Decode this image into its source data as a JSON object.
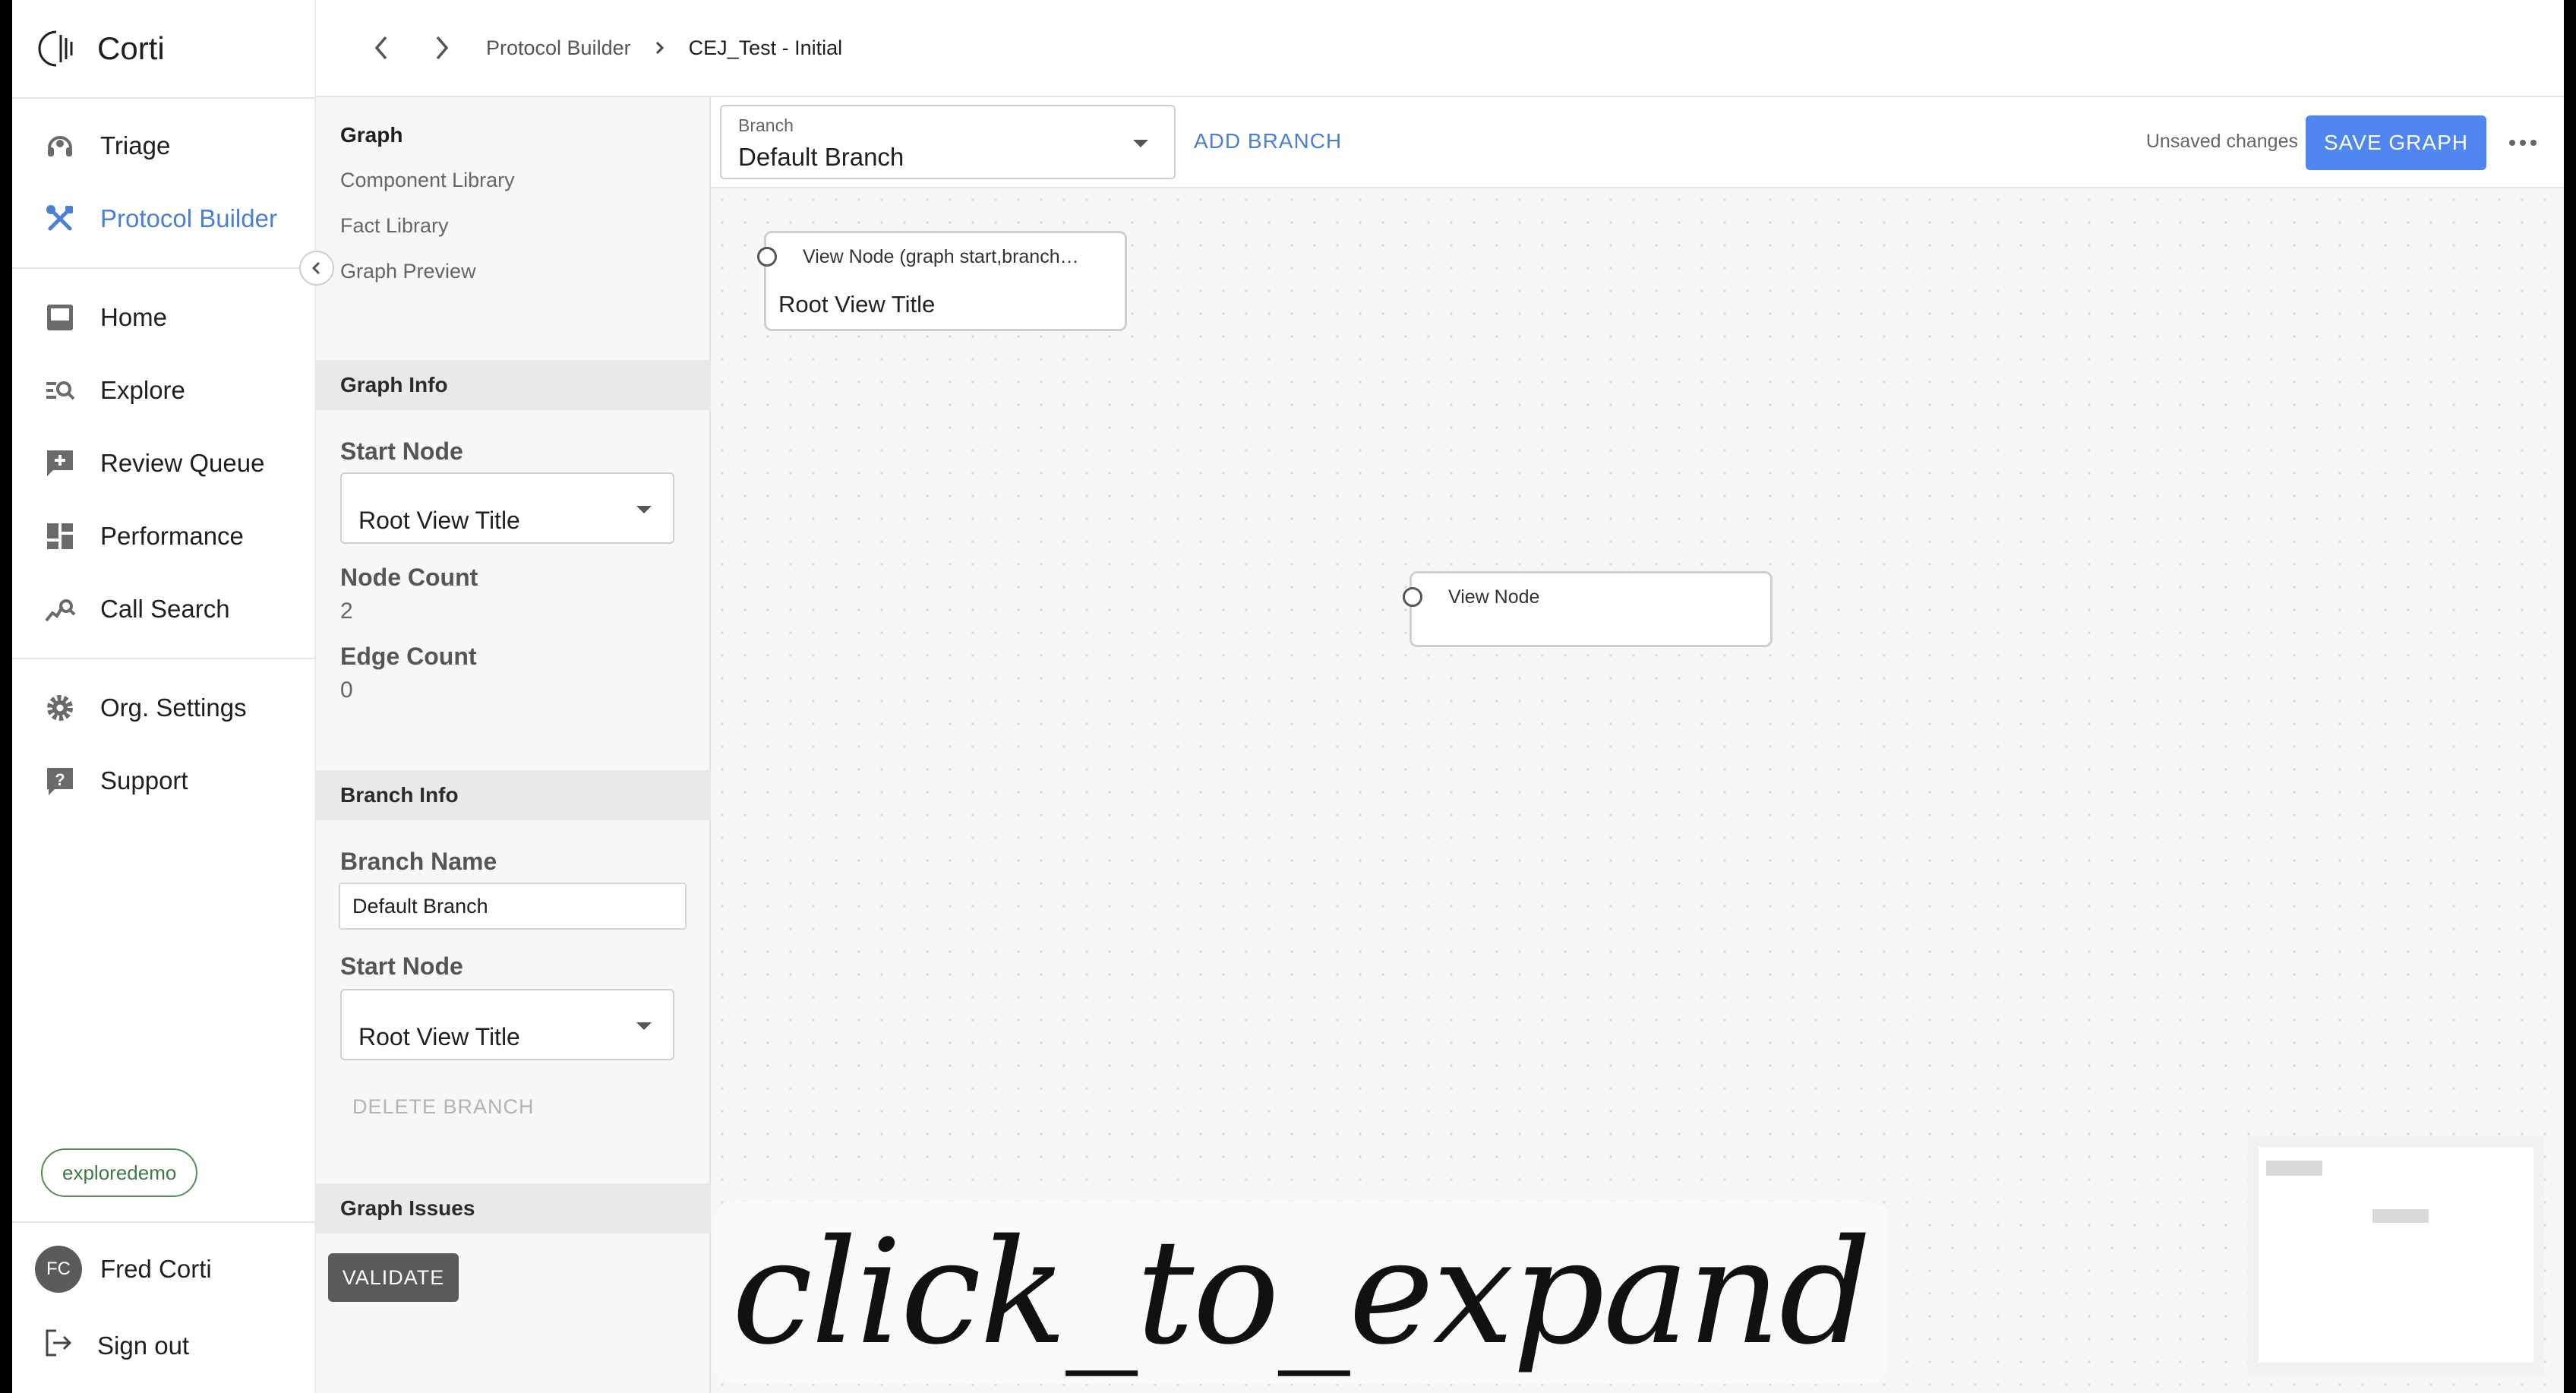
{
  "brand": {
    "name": "Corti"
  },
  "sidebar": {
    "items": [
      {
        "label": "Triage",
        "icon": "headset-icon"
      },
      {
        "label": "Protocol Builder",
        "icon": "tools-icon"
      },
      {
        "label": "Home",
        "icon": "inbox-icon"
      },
      {
        "label": "Explore",
        "icon": "explore-search-icon"
      },
      {
        "label": "Review Queue",
        "icon": "review-queue-icon"
      },
      {
        "label": "Performance",
        "icon": "dashboard-icon"
      },
      {
        "label": "Call Search",
        "icon": "call-search-icon"
      },
      {
        "label": "Org. Settings",
        "icon": "gear-icon"
      },
      {
        "label": "Support",
        "icon": "help-icon"
      }
    ],
    "tenant": "exploredemo",
    "user": {
      "initials": "FC",
      "name": "Fred Corti"
    },
    "signout": "Sign out"
  },
  "topbar": {
    "breadcrumb": [
      "Protocol Builder",
      "CEJ_Test - Initial"
    ]
  },
  "panel": {
    "nav": [
      "Graph",
      "Component Library",
      "Fact Library",
      "Graph Preview"
    ],
    "graph_info": {
      "title": "Graph Info",
      "start_node_label": "Start Node",
      "start_node_value": "Root View Title",
      "node_count_label": "Node Count",
      "node_count": "2",
      "edge_count_label": "Edge Count",
      "edge_count": "0"
    },
    "branch_info": {
      "title": "Branch Info",
      "branch_name_label": "Branch Name",
      "branch_name": "Default Branch",
      "start_node_label": "Start Node",
      "start_node_value": "Root View Title",
      "delete_label": "DELETE BRANCH"
    },
    "graph_issues": {
      "title": "Graph Issues",
      "validate_label": "VALIDATE"
    }
  },
  "toolbar": {
    "branch_label": "Branch",
    "branch_value": "Default Branch",
    "add_branch": "ADD BRANCH",
    "status": "Unsaved changes",
    "save": "SAVE GRAPH"
  },
  "nodes": [
    {
      "header": "View Node (graph start,branch…",
      "body": "Root View Title"
    },
    {
      "header": "View Node",
      "body": ""
    }
  ],
  "overlay": {
    "text": "click_to_expand"
  }
}
